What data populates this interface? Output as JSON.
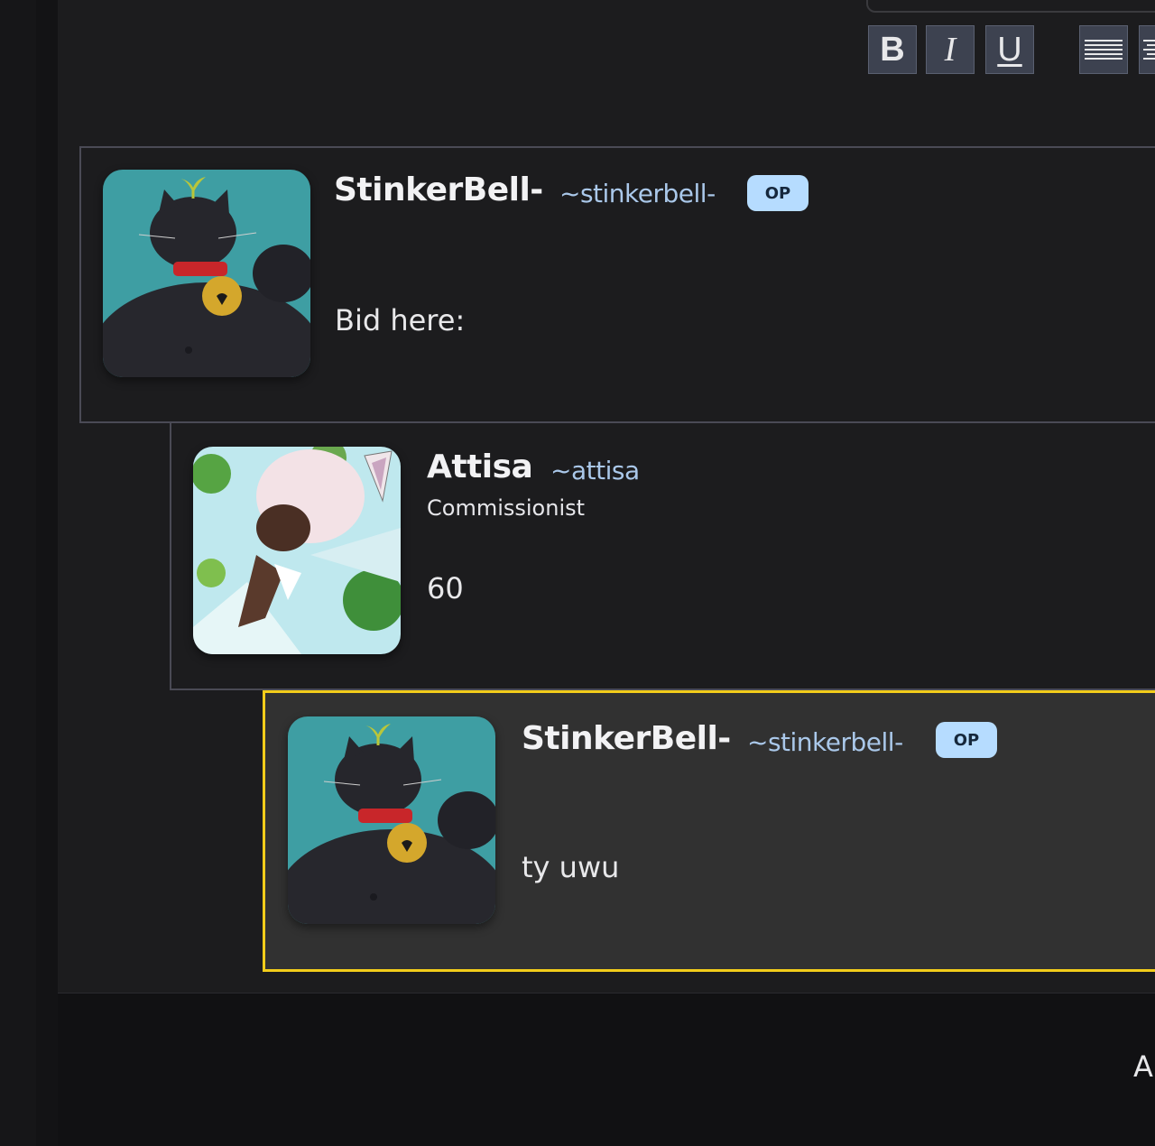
{
  "toolbar": {
    "bold": "B",
    "italic": "I",
    "underline": "U"
  },
  "comments": [
    {
      "username": "StinkerBell-",
      "handle": "~stinkerbell-",
      "badge": "OP",
      "body": "Bid here:"
    },
    {
      "username": "Attisa",
      "handle": "~attisa",
      "title": "Commissionist",
      "body": "60"
    },
    {
      "username": "StinkerBell-",
      "handle": "~stinkerbell-",
      "badge": "OP",
      "body": "ty uwu"
    }
  ],
  "footer": {
    "text": "A"
  },
  "colors": {
    "background": "#1c1c1e",
    "highlight_border": "#f2cc1a",
    "op_badge": "#b6dcff",
    "handle": "#aac8ea"
  }
}
